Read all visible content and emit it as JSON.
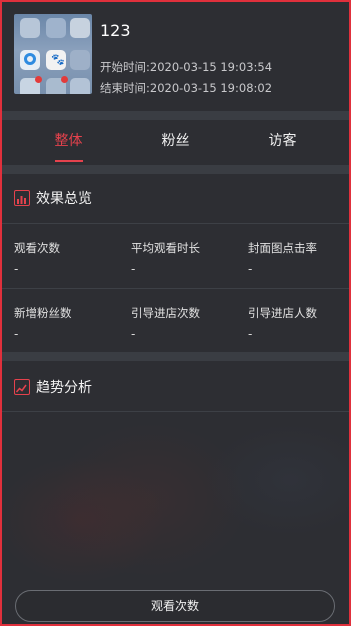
{
  "live": {
    "title": "123",
    "start_label": "开始时间:",
    "start_time": "2020-03-15 19:03:54",
    "end_label": "结束时间:",
    "end_time": "2020-03-15 19:08:02"
  },
  "tabs": [
    {
      "label": "整体",
      "active": true
    },
    {
      "label": "粉丝",
      "active": false
    },
    {
      "label": "访客",
      "active": false
    }
  ],
  "overview": {
    "title": "效果总览",
    "icon": "bar-chart-icon",
    "metrics": [
      {
        "label": "观看次数",
        "value": "-"
      },
      {
        "label": "平均观看时长",
        "value": "-"
      },
      {
        "label": "封面图点击率",
        "value": "-"
      },
      {
        "label": "新增粉丝数",
        "value": "-"
      },
      {
        "label": "引导进店次数",
        "value": "-"
      },
      {
        "label": "引导进店人数",
        "value": "-"
      }
    ]
  },
  "trend": {
    "title": "趋势分析",
    "icon": "line-chart-icon"
  },
  "bottom_button": {
    "label": "观看次数"
  },
  "colors": {
    "accent": "#e5424d",
    "background": "#2d2e33",
    "separator": "#3a3d43"
  }
}
